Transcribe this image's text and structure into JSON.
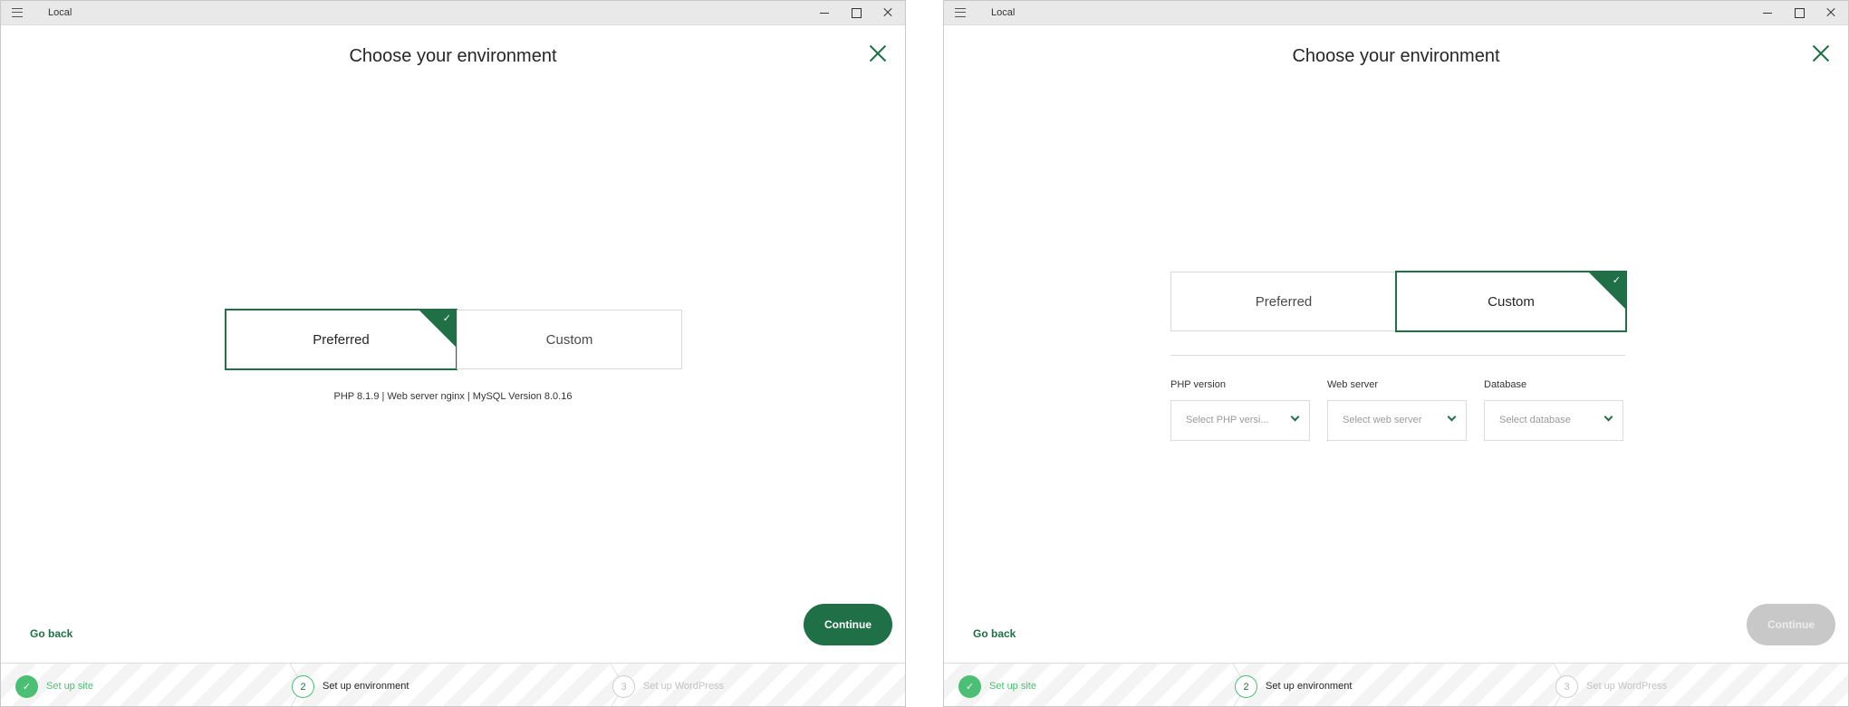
{
  "window": {
    "app_title": "Local"
  },
  "dialog": {
    "title": "Choose your environment"
  },
  "environment_options": {
    "preferred_label": "Preferred",
    "custom_label": "Custom"
  },
  "left_screen": {
    "selected_option": "Preferred",
    "environment_summary": "PHP 8.1.9 | Web server nginx | MySQL Version 8.0.16",
    "continue_enabled": true
  },
  "right_screen": {
    "selected_option": "Custom",
    "fields": [
      {
        "label": "PHP version",
        "placeholder": "Select PHP versi..."
      },
      {
        "label": "Web server",
        "placeholder": "Select web server"
      },
      {
        "label": "Database",
        "placeholder": "Select database"
      }
    ],
    "continue_enabled": false
  },
  "footer": {
    "go_back_label": "Go back",
    "continue_label": "Continue"
  },
  "steps": [
    {
      "number": "1",
      "label": "Set up site",
      "status": "done"
    },
    {
      "number": "2",
      "label": "Set up environment",
      "status": "active"
    },
    {
      "number": "3",
      "label": "Set up WordPress",
      "status": "future"
    }
  ],
  "colors": {
    "accent": "#1f6f47",
    "step_done": "#4bbf73",
    "disabled": "#c8c8c8"
  },
  "icons": {
    "check": "checkmark-icon",
    "close": "close-icon",
    "chevron": "chevron-down-icon",
    "menu": "hamburger-menu-icon"
  }
}
